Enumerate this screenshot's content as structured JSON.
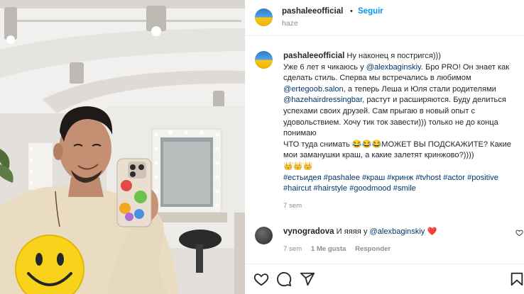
{
  "post": {
    "username": "pashaleeofficial",
    "follow_label": "Seguir",
    "separator": "•",
    "location": "haze"
  },
  "caption": {
    "username": "pashaleeofficial",
    "lines": [
      "Ну наконец я постригся)))",
      "Уже 6 лет я чикаюсь у ",
      "@alexbaginskiy",
      ". Бро PRO! Он знает как сделать стиль. Сперва мы встречались в любимом ",
      "@ertegoob.salon",
      ", а теперь Леша и Юля стали родителями ",
      "@hazehairdressingbar",
      ", растут и расширяются. Буду делиться успехами своих друзей. Сам прыгаю в новый опыт с удовольствием. Хочу тик ток завести))) только не до конца понимаю",
      "ЧТО туда снимать 😂😂😂МОЖЕТ ВЫ ПОДСКАЖИТЕ? Какие мои заманушки краш, а какие залетят кринжово?))))",
      "👑👑👑"
    ],
    "hashtags": "#естьидея #pashalee #краш #кринж #tvhost #actor #positive #haircut #hairstyle #goodmood #smile",
    "time": "7 sem"
  },
  "comment": {
    "username": "vynogradova",
    "text": "И яяяя у ",
    "mention": "@alexbaginskiy",
    "emoji": "❤️",
    "time": "7 sem",
    "likes": "1 Me gusta",
    "reply": "Responder"
  },
  "icons": {
    "like": "heart-icon",
    "comment": "comment-icon",
    "share": "paper-plane-icon",
    "save": "bookmark-icon"
  },
  "colors": {
    "link": "#00376b",
    "follow": "#0095f6",
    "muted": "#8e8e8e",
    "text": "#262626",
    "heart_red": "#ed4956"
  }
}
